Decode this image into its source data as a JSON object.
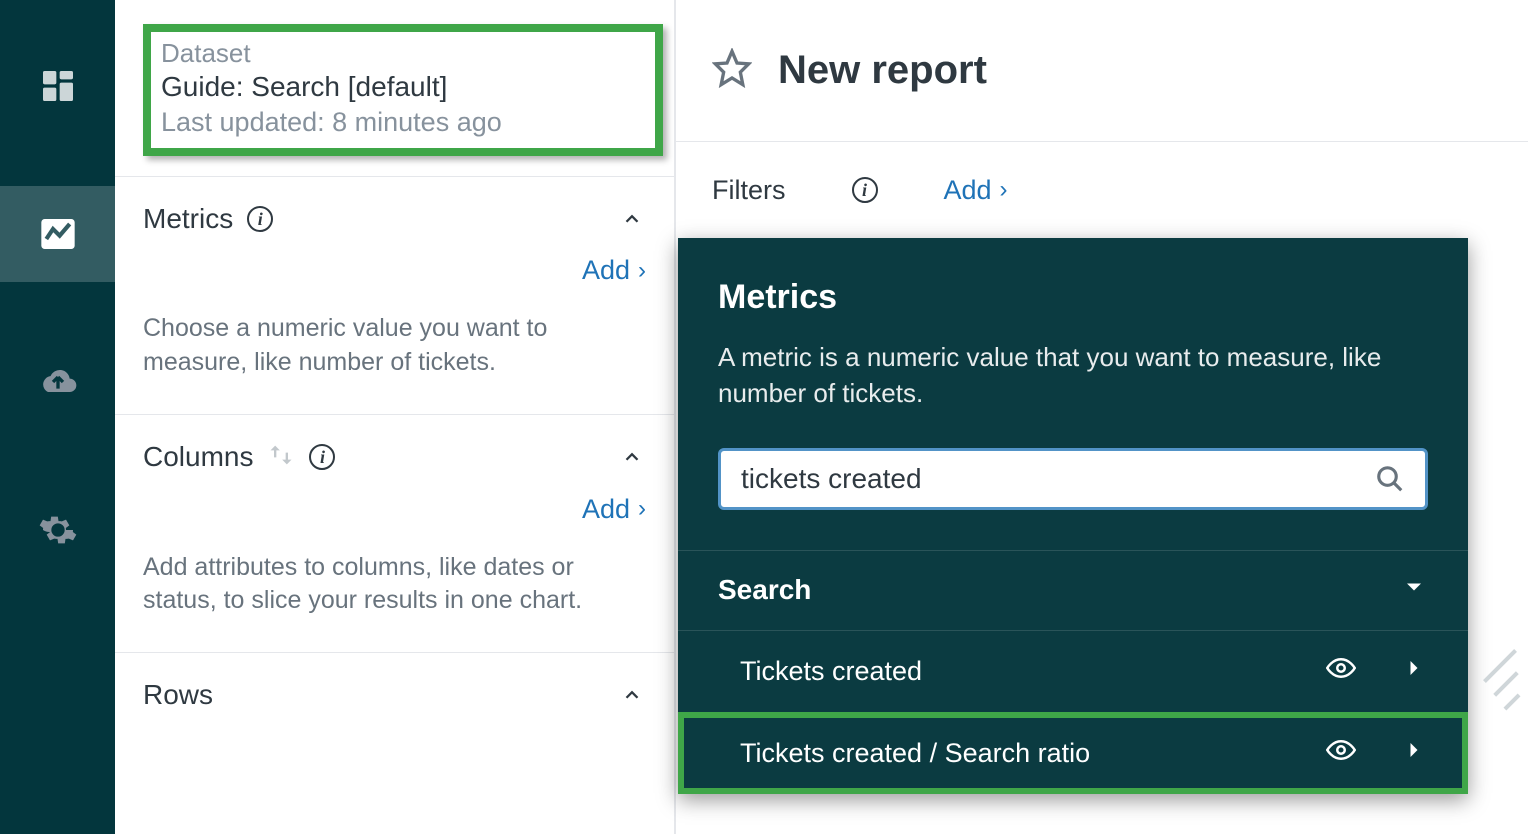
{
  "rail": {
    "items": [
      {
        "name": "dashboard-icon"
      },
      {
        "name": "reports-icon"
      },
      {
        "name": "upload-icon"
      },
      {
        "name": "settings-icon"
      }
    ],
    "active_index": 1
  },
  "dataset": {
    "label": "Dataset",
    "name": "Guide: Search [default]",
    "updated": "Last updated: 8 minutes ago"
  },
  "sections": {
    "metrics": {
      "title": "Metrics",
      "add_label": "Add",
      "help": "Choose a numeric value you want to measure, like number of tickets."
    },
    "columns": {
      "title": "Columns",
      "add_label": "Add",
      "help": "Add attributes to columns, like dates or status, to slice your results in one chart."
    },
    "rows": {
      "title": "Rows"
    }
  },
  "main": {
    "report_title": "New report",
    "filters_label": "Filters",
    "filters_add": "Add"
  },
  "picker": {
    "title": "Metrics",
    "description": "A metric is a numeric value that you want to measure, like number of tickets.",
    "search_value": "tickets created",
    "group_label": "Search",
    "items": [
      {
        "label": "Tickets created",
        "highlighted": false
      },
      {
        "label": "Tickets created / Search ratio",
        "highlighted": true
      }
    ]
  }
}
